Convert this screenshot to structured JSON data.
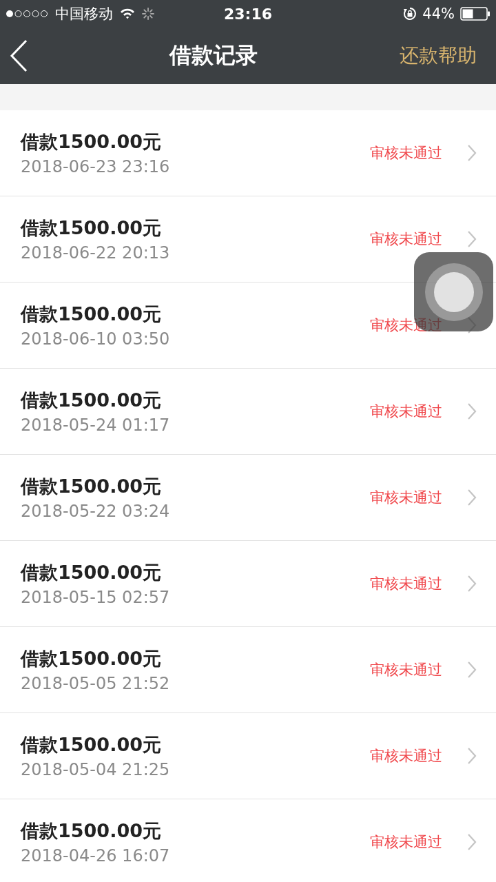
{
  "status_bar": {
    "carrier": "中国移动",
    "time": "23:16",
    "battery": "44%"
  },
  "nav": {
    "title": "借款记录",
    "action": "还款帮助"
  },
  "records": [
    {
      "title": "借款1500.00元",
      "date": "2018-06-23 23:16",
      "status": "审核未通过"
    },
    {
      "title": "借款1500.00元",
      "date": "2018-06-22 20:13",
      "status": "审核未通过"
    },
    {
      "title": "借款1500.00元",
      "date": "2018-06-10 03:50",
      "status": "审核未通过"
    },
    {
      "title": "借款1500.00元",
      "date": "2018-05-24 01:17",
      "status": "审核未通过"
    },
    {
      "title": "借款1500.00元",
      "date": "2018-05-22 03:24",
      "status": "审核未通过"
    },
    {
      "title": "借款1500.00元",
      "date": "2018-05-15 02:57",
      "status": "审核未通过"
    },
    {
      "title": "借款1500.00元",
      "date": "2018-05-05 21:52",
      "status": "审核未通过"
    },
    {
      "title": "借款1500.00元",
      "date": "2018-05-04 21:25",
      "status": "审核未通过"
    },
    {
      "title": "借款1500.00元",
      "date": "2018-04-26 16:07",
      "status": "审核未通过"
    }
  ]
}
